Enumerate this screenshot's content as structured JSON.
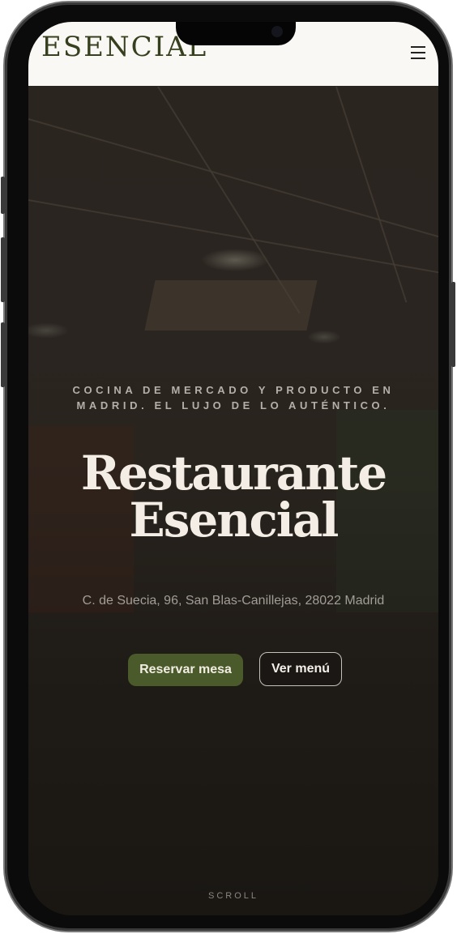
{
  "header": {
    "logo": "ESENCIAL",
    "menu_icon": "hamburger-menu-icon"
  },
  "hero": {
    "tagline": "COCINA DE MERCADO Y PRODUCTO EN MADRID. EL LUJO DE LO AUTÉNTICO.",
    "title_line1": "Restaurante",
    "title_line2": "Esencial",
    "address": "C. de Suecia, 96, San Blas-Canillejas, 28022 Madrid",
    "primary_button": "Reservar mesa",
    "secondary_button": "Ver menú",
    "scroll_label": "SCROLL"
  },
  "colors": {
    "brand_green": "#4b5a2a",
    "logo_green": "#36401e",
    "header_background": "#faf8f4",
    "hero_overlay": "#241d18"
  }
}
